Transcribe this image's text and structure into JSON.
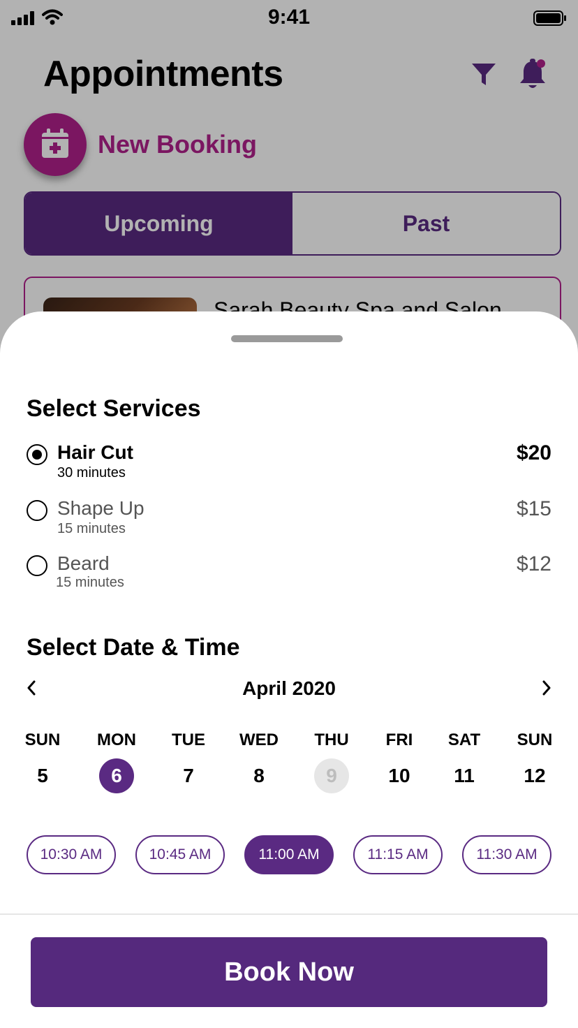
{
  "status_bar": {
    "time": "9:41"
  },
  "header": {
    "title": "Appointments",
    "filter_icon": "filter-icon",
    "bell_icon": "bell-icon"
  },
  "new_booking": {
    "label": "New Booking",
    "icon": "calendar-plus-icon"
  },
  "tabs": [
    {
      "label": "Upcoming",
      "active": true
    },
    {
      "label": "Past",
      "active": false
    }
  ],
  "appointment_card": {
    "name": "Sarah Beauty Spa and Salon"
  },
  "sheet": {
    "services_title": "Select Services",
    "services": [
      {
        "name": "Hair Cut",
        "duration": "30 minutes",
        "price": "$20",
        "selected": true
      },
      {
        "name": "Shape Up",
        "duration": "15 minutes",
        "price": "$15",
        "selected": false
      },
      {
        "name": "Beard",
        "duration": "15 minutes",
        "price": "$12",
        "selected": false
      }
    ],
    "datetime_title": "Select Date & Time",
    "month": "April 2020",
    "days": [
      {
        "name": "SUN",
        "num": "5",
        "state": "normal"
      },
      {
        "name": "MON",
        "num": "6",
        "state": "selected"
      },
      {
        "name": "TUE",
        "num": "7",
        "state": "normal"
      },
      {
        "name": "WED",
        "num": "8",
        "state": "normal"
      },
      {
        "name": "THU",
        "num": "9",
        "state": "disabled"
      },
      {
        "name": "FRI",
        "num": "10",
        "state": "normal"
      },
      {
        "name": "SAT",
        "num": "11",
        "state": "normal"
      },
      {
        "name": "SUN",
        "num": "12",
        "state": "normal"
      }
    ],
    "times": [
      {
        "label": "10:30 AM",
        "selected": false
      },
      {
        "label": "10:45 AM",
        "selected": false
      },
      {
        "label": "11:00 AM",
        "selected": true
      },
      {
        "label": "11:15 AM",
        "selected": false
      },
      {
        "label": "11:30 AM",
        "selected": false
      }
    ],
    "book_label": "Book Now"
  },
  "colors": {
    "primary": "#5a2a82",
    "accent": "#b0208c",
    "button": "#55297d"
  }
}
